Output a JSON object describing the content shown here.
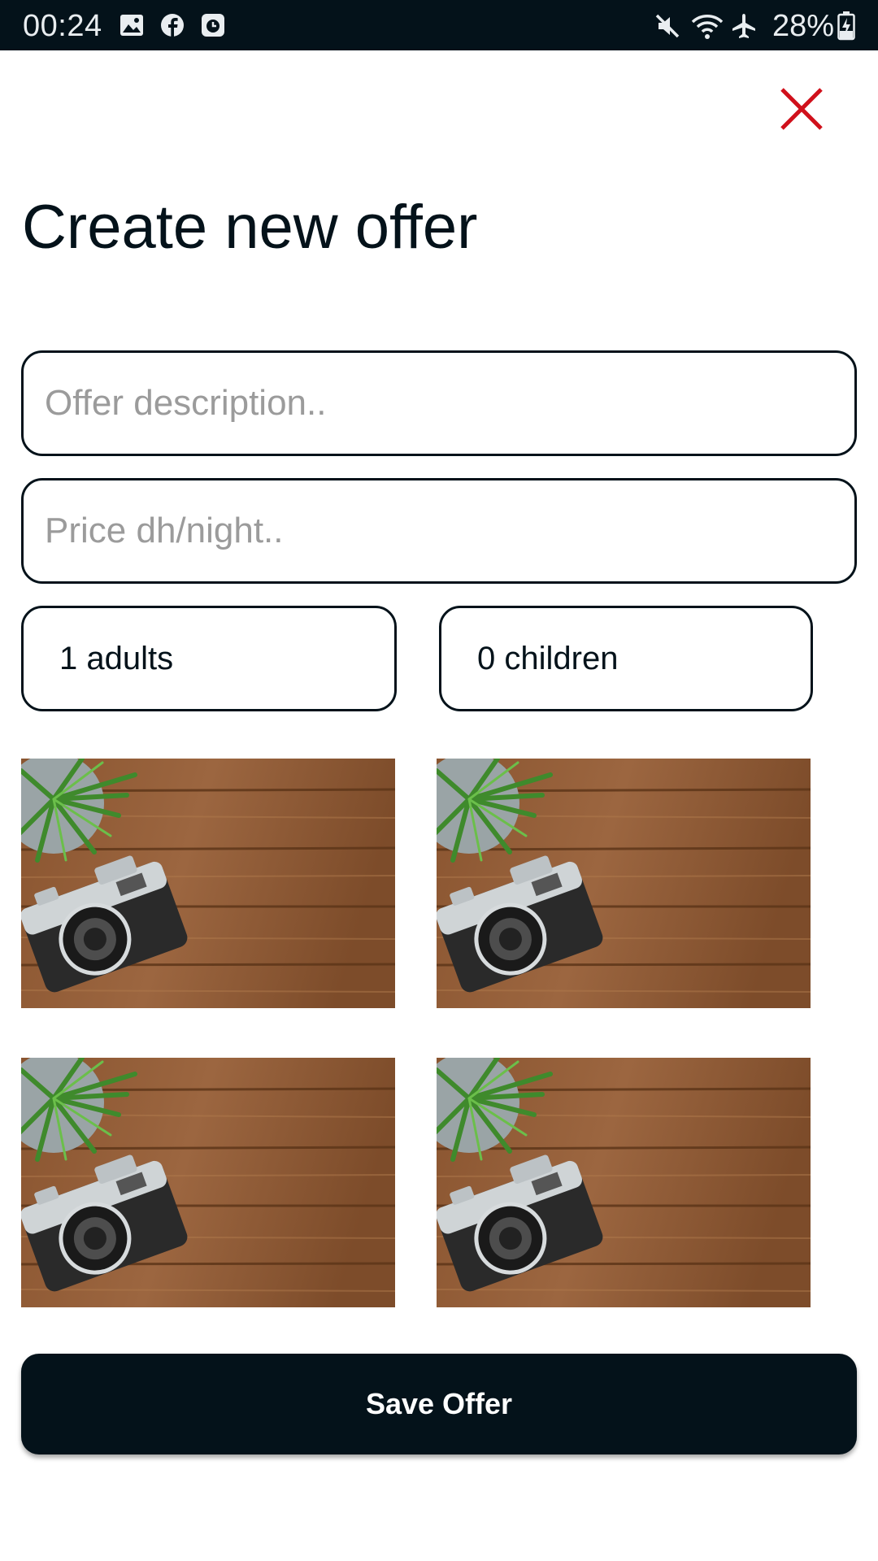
{
  "status_bar": {
    "time": "00:24",
    "battery": "28%",
    "icons": [
      "image-icon",
      "facebook-icon",
      "clock-app-icon",
      "mute-icon",
      "wifi-icon",
      "airplane-icon",
      "battery-charging-icon"
    ]
  },
  "close": {
    "icon": "close-icon",
    "color": "#d0101b"
  },
  "title": "Create new offer",
  "form": {
    "description_placeholder": "Offer description..",
    "price_placeholder": "Price dh/night..",
    "adults": "1 adults",
    "children": "0 children"
  },
  "photos": [
    "camera-photo",
    "camera-photo",
    "camera-photo",
    "camera-photo"
  ],
  "save_label": "Save Offer",
  "colors": {
    "dark": "#04121a",
    "accent": "#d0101b",
    "placeholder": "#9b9b9b"
  }
}
